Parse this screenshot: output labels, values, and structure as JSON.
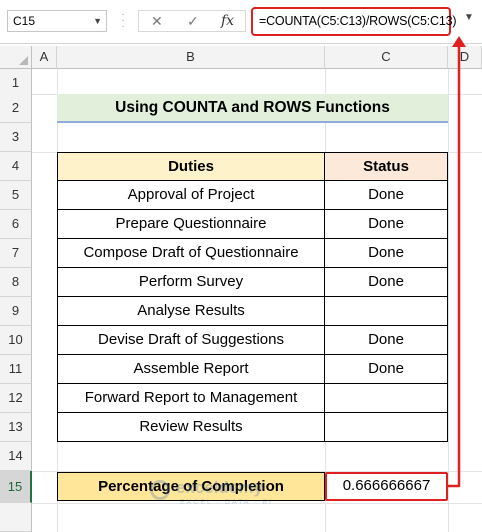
{
  "formula_bar": {
    "name_box": "C15",
    "formula": "=COUNTA(C5:C13)/ROWS(C5:C13)"
  },
  "columns": [
    "A",
    "B",
    "C",
    "D"
  ],
  "rows": [
    "1",
    "2",
    "3",
    "4",
    "5",
    "6",
    "7",
    "8",
    "9",
    "10",
    "11",
    "12",
    "13",
    "14",
    "15"
  ],
  "title": "Using COUNTA and ROWS Functions",
  "table": {
    "headers": [
      "Duties",
      "Status"
    ],
    "rows": [
      {
        "duty": "Approval of Project",
        "status": "Done"
      },
      {
        "duty": "Prepare Questionnaire",
        "status": "Done"
      },
      {
        "duty": "Compose Draft of Questionnaire",
        "status": "Done"
      },
      {
        "duty": "Perform Survey",
        "status": "Done"
      },
      {
        "duty": "Analyse Results",
        "status": ""
      },
      {
        "duty": "Devise Draft of Suggestions",
        "status": "Done"
      },
      {
        "duty": "Assemble Report",
        "status": "Done"
      },
      {
        "duty": "Forward Report to Management",
        "status": ""
      },
      {
        "duty": "Review Results",
        "status": ""
      }
    ]
  },
  "summary": {
    "label": "Percentage of Completion",
    "value": "0.666666667"
  },
  "watermark": {
    "name": "exceldemy",
    "tagline": "EXCEL · DATA · BI"
  },
  "colors": {
    "title_fill": "#e2efda",
    "header_duties": "#fef2cb",
    "header_status": "#fde9d9",
    "summary_fill": "#ffe699",
    "highlight": "#e02020"
  }
}
